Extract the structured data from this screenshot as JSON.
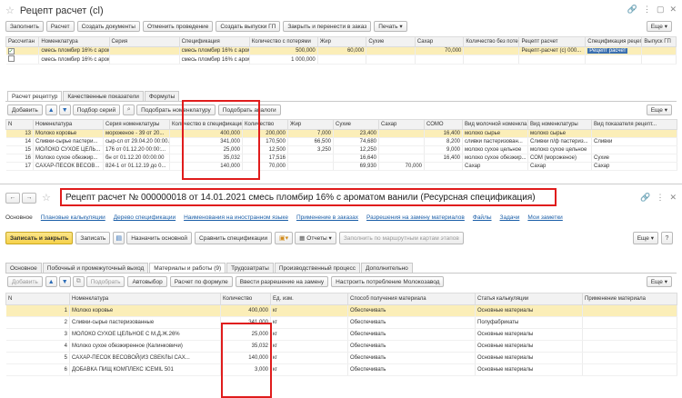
{
  "top": {
    "title": "Рецепт расчет (cl)",
    "toolbar": [
      "Заполнить",
      "Расчет",
      "Создать документы",
      "Отменить проведение",
      "Создать выпуски ГП",
      "Закрыть и перенести в заказ",
      "Печать"
    ],
    "more": "Еще",
    "grid1": {
      "headers": [
        "Рассчитан",
        "Номенклатура",
        "Серия",
        "Спецификация",
        "Количество с потерями",
        "Жир",
        "Сухие",
        "Сахар",
        "Количество без потерь",
        "Рецепт расчет",
        "Спецификация рецепт",
        "Выпуск ГП"
      ],
      "rows": [
        {
          "checked": true,
          "nom": "смесь пломбир 16% с аромат",
          "spec": "смесь пломбир 16% с аромат",
          "qty": "500,000",
          "fat": "60,000",
          "dry": "",
          "sugar": "70,000",
          "qty2": "",
          "rr": "Рецепт-расчет (с) 000...",
          "sr": "Рецепт расчет"
        },
        {
          "checked": false,
          "nom": "смесь пломбир 16% с аромат",
          "spec": "смесь пломбир 16% с аромат",
          "qty": "1 000,000",
          "fat": "",
          "dry": "",
          "sugar": "",
          "qty2": "",
          "rr": "",
          "sr": ""
        }
      ]
    },
    "tabs": [
      "Расчет рецептур",
      "Качественные показатели",
      "Формулы"
    ],
    "toolbar2": [
      "Добавить",
      "Подбор серий",
      "Подобрать номенклатуру",
      "Подобрать аналоги"
    ],
    "grid2": {
      "headers": [
        "N",
        "Номенклатура",
        "Серия номенклатуры",
        "Количество в спецификации",
        "Количество",
        "Жир",
        "Сухие",
        "Сахар",
        "СОМО",
        "Вид молочной номенкла...",
        "Вид номенклатуры",
        "Вид показателя рецепт..."
      ],
      "rows": [
        {
          "n": "13",
          "nom": "Молоко коровье",
          "ser": "мороженое - 39 от 20...",
          "qs": "400,000",
          "q": "200,000",
          "fat": "7,000",
          "dry": "23,400",
          "sugar": "",
          "somo": "16,400",
          "vm": "молоко сырье",
          "vn": "молоко сырье",
          "vp": ""
        },
        {
          "n": "14",
          "nom": "Сливки-сырье пастери...",
          "ser": "сыр-сл от 29.04.20 00:00...",
          "qs": "341,000",
          "q": "170,500",
          "fat": "66,500",
          "dry": "74,680",
          "sugar": "",
          "somo": "8,200",
          "vm": "сливки пастеризован...",
          "vn": "Сливки п/ф пастериз...",
          "vp": "Сливки"
        },
        {
          "n": "15",
          "nom": "МОЛОКО СУХОЕ ЦЕЛЬ...",
          "ser": "176 от 01.12.20 00:00:...",
          "qs": "25,000",
          "q": "12,500",
          "fat": "3,250",
          "dry": "12,250",
          "sugar": "",
          "somo": "9,000",
          "vm": "молоко сухое цельное",
          "vn": "молоко сухое цельное",
          "vp": ""
        },
        {
          "n": "16",
          "nom": "Молоко сухое обезжир...",
          "ser": "бн от 01.12.20 00:00:00",
          "qs": "35,032",
          "q": "17,516",
          "fat": "",
          "dry": "16,640",
          "sugar": "",
          "somo": "16,400",
          "vm": "молоко сухое обезжир...",
          "vn": "СОМ (мороженое)",
          "vp": "Сухие"
        },
        {
          "n": "17",
          "nom": "САХАР-ПЕСОК ВЕСОВ...",
          "ser": "824-1 от 01.12.19 до 0...",
          "qs": "140,000",
          "q": "70,000",
          "fat": "",
          "dry": "69,930",
          "sugar": "70,000",
          "somo": "",
          "vm": "Сахар",
          "vn": "Сахар",
          "vp": "Сахар"
        }
      ]
    }
  },
  "bottom": {
    "title": "Рецепт расчет № 000000018 от 14.01.2021 смесь пломбир 16% с ароматом ванили (Ресурсная спецификация)",
    "nav": [
      "Основное",
      "Плановые калькуляции",
      "Дерево спецификации",
      "Наименования на иностранном языке",
      "Применение в заказах",
      "Разрешения на замену материалов",
      "Файлы",
      "Задачи",
      "Мои заметки"
    ],
    "toolbar": [
      "Записать и закрыть",
      "Записать",
      "Назначить основной",
      "Сравнить спецификации",
      "Отчеты",
      "Заполнить по маршрутным картам этапов"
    ],
    "more": "Еще",
    "tabs": [
      "Основное",
      "Побочный и промежуточный выход",
      "Материалы и работы (9)",
      "Трудозатраты",
      "Производственный процесс",
      "Дополнительно"
    ],
    "toolbar2": [
      "Добавить",
      "Подобрать",
      "Автовыбор",
      "Расчет по формуле",
      "Ввести разрешение на замену",
      "Настроить потребление Молокозавод"
    ],
    "headers": [
      "N",
      "Номенклатура",
      "Количество",
      "Ед. изм.",
      "Способ получения материала",
      "Статья калькуляции",
      "Применение материала"
    ],
    "rows": [
      {
        "n": "1",
        "nom": "Молоко коровье",
        "qty": "400,000",
        "unit": "кг",
        "way": "Обеспечивать",
        "art": "Основные материалы",
        "app": ""
      },
      {
        "n": "2",
        "nom": "Сливки-сырье пастеризованные",
        "qty": "341,000",
        "unit": "кг",
        "way": "Обеспечивать",
        "art": "Полуфабрикаты",
        "app": ""
      },
      {
        "n": "3",
        "nom": "МОЛОКО СУХОЕ ЦЕЛЬНОЕ С М.Д.Ж.26%",
        "qty": "25,000",
        "unit": "кг",
        "way": "Обеспечивать",
        "art": "Основные материалы",
        "app": ""
      },
      {
        "n": "4",
        "nom": "Молоко сухое обезжиренное (Калинковичи)",
        "qty": "35,032",
        "unit": "кг",
        "way": "Обеспечивать",
        "art": "Основные материалы",
        "app": ""
      },
      {
        "n": "5",
        "nom": "САХАР-ПЕСОК ВЕСОВОЙ(ИЗ СВЕКЛЫ САХ...",
        "qty": "140,000",
        "unit": "кг",
        "way": "Обеспечивать",
        "art": "Основные материалы",
        "app": ""
      },
      {
        "n": "6",
        "nom": "ДОБАВКА ПИЩ КОМПЛЕКС ICEMIL 501",
        "qty": "3,000",
        "unit": "кг",
        "way": "Обеспечивать",
        "art": "Основные материалы",
        "app": ""
      }
    ]
  },
  "colors": {
    "accent": "#f6d14a",
    "red": "#e01c1c",
    "link": "#1a5ea8",
    "selected": "#fbeeb8"
  }
}
